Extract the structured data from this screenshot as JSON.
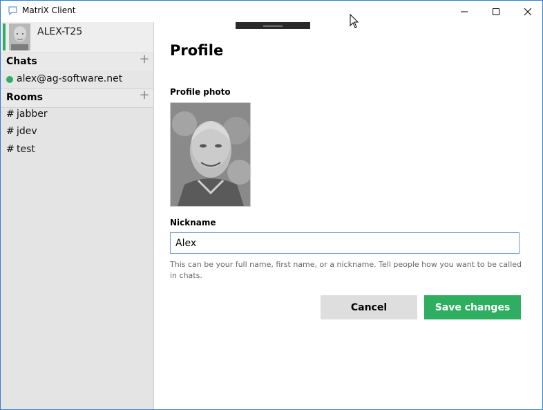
{
  "window": {
    "title": "MatriX Client",
    "controls": [
      "minimize",
      "maximize",
      "close"
    ]
  },
  "sidebar": {
    "account": {
      "name": "ALEX-T25"
    },
    "chats": {
      "title": "Chats",
      "add_icon": "+",
      "items": [
        {
          "label": "alex@ag-software.net",
          "status": "online"
        }
      ]
    },
    "rooms": {
      "title": "Rooms",
      "add_icon": "+",
      "items": [
        {
          "hash": "#",
          "label": "jabber"
        },
        {
          "hash": "#",
          "label": "jdev"
        },
        {
          "hash": "#",
          "label": "test"
        }
      ]
    }
  },
  "profile": {
    "title": "Profile",
    "photo_label": "Profile photo",
    "nickname_label": "Nickname",
    "nickname_value": "Alex",
    "hint": "This can be your full name, first name, or a nickname. Tell people how you want to be called in chats.",
    "cancel_label": "Cancel",
    "save_label": "Save changes"
  },
  "colors": {
    "accent_green": "#2eae60",
    "sidebar_bg": "#e4e4e4",
    "input_border": "#6a9bc9"
  },
  "icons": [
    "chat-bubble-icon",
    "minimize-icon",
    "maximize-icon",
    "close-icon",
    "mouse-cursor-icon",
    "add-icon",
    "online-status-icon",
    "drag-grip-icon"
  ]
}
